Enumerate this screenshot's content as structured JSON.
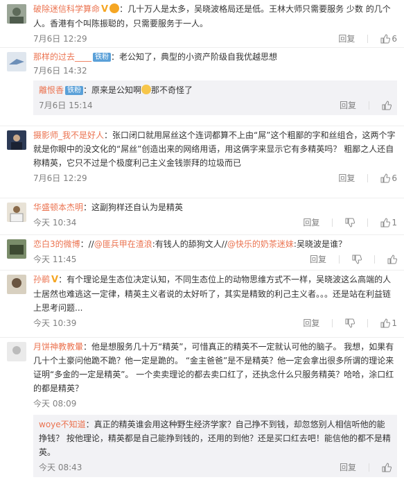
{
  "labels": {
    "reply": "回复"
  },
  "comments": [
    {
      "user": "破除迷信科学算命",
      "text": "：几十万人是太多，吴晓波格局还是低。王林大师只需要服务 少数 的几个人。香港有个叫陈振聪的，只需要服务于一人。",
      "time": "7月6日 12:29",
      "likes": "6"
    },
    {
      "user": "那样的过去____",
      "badge": "铁粉",
      "text": "：老公知了，典型的小资产阶级自我优越思想",
      "time": "7月6日 14:32",
      "sub": {
        "user": "離恨香",
        "badge": "铁粉",
        "text_before": "：原来是公知啊",
        "text_after": "那不奇怪了",
        "time": "7月6日 15:14"
      }
    },
    {
      "user": "摄影师_我不是好人",
      "text": "：张口闭口就用屌丝这个连词都算不上由“屌”这个粗鄙的字和丝组合，这两个字就是你眼中的没文化的“屌丝”创造出来的网络用语，用这俩字来显示它有多精英吗？ 粗鄙之人还自称精英，它只不过是个极度利己主义金钱崇拜的垃圾而已",
      "time": "7月6日 12:29",
      "likes": "6"
    },
    {
      "user": "华盛顿本杰明",
      "text": "：这副狗样还自认为是精英",
      "time": "今天 10:34",
      "likes": "1"
    },
    {
      "user": "恋白3的微博",
      "text_a": "：//",
      "at1": "@匪兵甲在渣浪",
      "text_b": ":有钱人的舔狗文人//",
      "at2": "@快乐的奶茶迷妹",
      "text_c": ":吴晓波是谁？",
      "time": "今天 11:45"
    },
    {
      "user": "孙鹡",
      "text": "：有个理论是生态位决定认知，不同生态位上的动物思维方式不一样，吴晓波这么高端的人士居然也难逃这一定律，精英主义者说的太好听了，其实是精致的利己主义者。。。还是站在利益链上思考问题...",
      "time": "今天 10:39",
      "likes": "1"
    },
    {
      "user": "月饼神教教暈",
      "text": "：他是想服务几十万“精英”，可惜真正的精英不一定就认可他的脑子。 我想，如果有几十个土豪问他跪不跪？他一定是跪的。 “金主爸爸”是不是精英？他一定会拿出很多所谓的理论来证明“多金的一定是精英”。 一个卖卖理论的都去卖口红了，还执念什么只服务精英？哈哈，涂口红的都是精英？",
      "time": "今天 08:09",
      "sub": {
        "user": "woye不知道",
        "text": "：真正的精英谁会用这种野生经济学家？自己挣不到钱，却忽悠别人相信听他的能挣钱？ 按他理论，精英都是自己能挣到钱的，还用的到他？还是买口红去吧！能信他的都不是精英。",
        "time": "今天 08:43"
      }
    }
  ],
  "colors": {
    "username": "#eb7350",
    "badge": "#5aa0d8",
    "muted": "#808080"
  },
  "icons": [
    "vip-icon",
    "like-icon",
    "reply-icon",
    "badge-icon",
    "emoji-icon"
  ]
}
